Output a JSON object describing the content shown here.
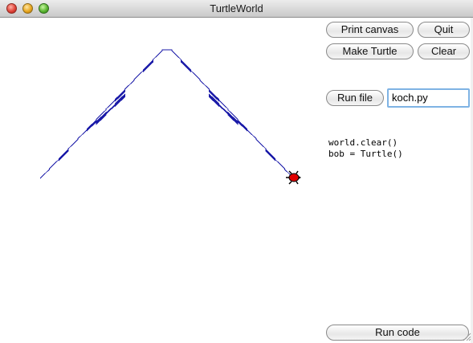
{
  "window": {
    "title": "TurtleWorld"
  },
  "buttons": {
    "print_canvas": "Print canvas",
    "quit": "Quit",
    "make_turtle": "Make Turtle",
    "clear": "Clear",
    "run_file": "Run file",
    "run_code": "Run code"
  },
  "file_entry": {
    "value": "koch.py"
  },
  "code": {
    "text": "world.clear()\nbob = Turtle()"
  },
  "colors": {
    "curve": "#1a1aa8",
    "turtle": "#e00000",
    "input_focus": "#7fb3e4"
  },
  "icons": {
    "turtle": "turtle-icon",
    "resize": "resize-grip-icon"
  }
}
